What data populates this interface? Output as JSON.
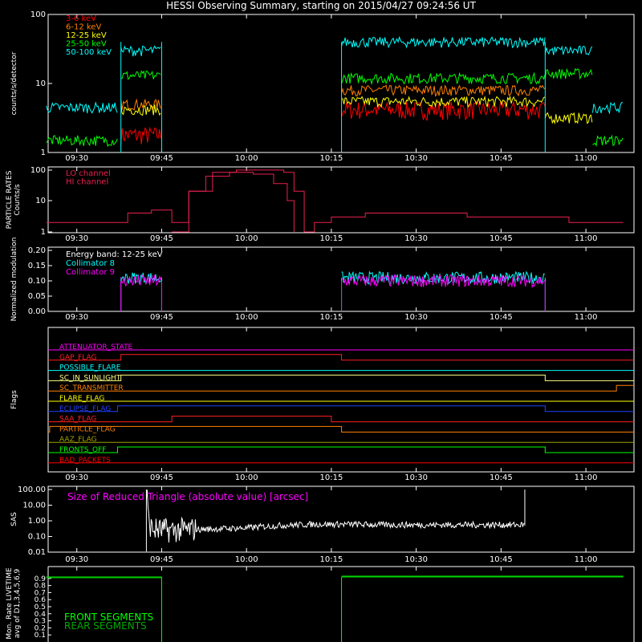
{
  "title": "HESSI Observing Summary, starting on 2015/04/27 09:24:56 UT",
  "time_ticks": [
    "09:30",
    "09:45",
    "10:00",
    "10:15",
    "10:30",
    "10:45",
    "11:00"
  ],
  "colors": {
    "lo": "#ff0000",
    "b612": "#ff8000",
    "b1225": "#ffff00",
    "b2550": "#00ff00",
    "b50100": "#00ffff",
    "particle": "#e8204f",
    "col8": "#00ffff",
    "col9": "#ff00ff",
    "sas_label": "#ff00ff",
    "front": "#00ff00",
    "rear": "#00aa00"
  },
  "chart_data": [
    {
      "type": "line",
      "id": "counts",
      "ylabel": "counts/s/detector",
      "yscale": "log",
      "ylim": [
        1,
        100
      ],
      "yticks": [
        "100",
        "10",
        "1"
      ],
      "legend": [
        "3-6 keV",
        "6-12 keV",
        "12-25 keV",
        "25-50 keV",
        "50-100 keV"
      ],
      "series": [
        {
          "name": "3-6 keV",
          "segments": [
            {
              "x0": 9.63,
              "x1": 9.75,
              "y": 1.8
            },
            {
              "x0": 10.28,
              "x1": 10.88,
              "y": 4.2
            }
          ]
        },
        {
          "name": "6-12 keV",
          "segments": [
            {
              "x0": 9.63,
              "x1": 9.75,
              "y": 5.0
            },
            {
              "x0": 10.28,
              "x1": 10.88,
              "y": 8.0
            }
          ]
        },
        {
          "name": "12-25 keV",
          "segments": [
            {
              "x0": 9.63,
              "x1": 9.75,
              "y": 4.2
            },
            {
              "x0": 10.28,
              "x1": 10.88,
              "y": 5.5
            },
            {
              "x0": 10.88,
              "x1": 11.02,
              "y": 3.2
            }
          ]
        },
        {
          "name": "25-50 keV",
          "segments": [
            {
              "x0": 9.41,
              "x1": 9.62,
              "y": 1.5
            },
            {
              "x0": 9.63,
              "x1": 9.75,
              "y": 13
            },
            {
              "x0": 10.28,
              "x1": 10.88,
              "y": 12
            },
            {
              "x0": 10.88,
              "x1": 11.02,
              "y": 14
            },
            {
              "x0": 11.02,
              "x1": 11.11,
              "y": 1.5
            }
          ]
        },
        {
          "name": "50-100 keV",
          "segments": [
            {
              "x0": 9.41,
              "x1": 9.62,
              "y": 4.5
            },
            {
              "x0": 9.63,
              "x1": 9.75,
              "y": 30
            },
            {
              "x0": 10.28,
              "x1": 10.88,
              "y": 40
            },
            {
              "x0": 10.88,
              "x1": 11.02,
              "y": 30
            },
            {
              "x0": 11.02,
              "x1": 11.11,
              "y": 4.5
            }
          ]
        }
      ]
    },
    {
      "type": "line",
      "id": "particle",
      "ylabel": "PARTICLE RATES Counts/s",
      "ylim": [
        0,
        100
      ],
      "yticks": [
        "100",
        "10",
        "1"
      ],
      "legend": [
        "LO channel",
        "HI channel"
      ],
      "series": [
        {
          "name": "LO channel",
          "x": [
            9.41,
            9.55,
            9.65,
            9.72,
            9.78,
            9.83,
            9.9,
            9.97,
            10.05,
            10.11,
            10.14,
            10.17,
            10.2,
            10.25,
            10.35,
            10.5,
            10.65,
            10.8,
            10.95,
            11.11
          ],
          "y": [
            2,
            2,
            4,
            5,
            2,
            20,
            80,
            95,
            95,
            80,
            20,
            1,
            2,
            3,
            4,
            4,
            3,
            3,
            2,
            2
          ]
        },
        {
          "name": "HI channel",
          "x": [
            9.78,
            9.83,
            9.88,
            9.95,
            10.02,
            10.08,
            10.12,
            10.14
          ],
          "y": [
            1,
            20,
            60,
            80,
            70,
            35,
            10,
            1
          ]
        }
      ]
    },
    {
      "type": "line",
      "id": "modulation",
      "ylabel": "Normalized modulation",
      "ylim": [
        0,
        0.2
      ],
      "yticks": [
        "0.20",
        "0.15",
        "0.10",
        "0.05",
        "0.00"
      ],
      "legend": [
        "Energy band: 12-25 keV",
        "Collimator 8",
        "Collimator 9"
      ],
      "series": [
        {
          "name": "Collimator 8",
          "segments": [
            {
              "x0": 9.63,
              "x1": 9.75,
              "y": 0.11
            },
            {
              "x0": 10.28,
              "x1": 10.88,
              "y": 0.11
            }
          ]
        },
        {
          "name": "Collimator 9",
          "segments": [
            {
              "x0": 9.63,
              "x1": 9.75,
              "y": 0.1
            },
            {
              "x0": 10.28,
              "x1": 10.88,
              "y": 0.1
            }
          ]
        }
      ]
    },
    {
      "type": "line",
      "id": "flags",
      "ylabel": "Flags",
      "legend": [
        "ATTENUATOR_STATE",
        "GAP_FLAG",
        "POSSIBLE_FLARE",
        "SC_IN_SUNLIGHT",
        "SC_TRANSMITTER",
        "FLARE_FLAG",
        "ECLIPSE_FLAG",
        "SAA_FLAG",
        "PARTICLE_FLAG",
        "AAZ_FLAG",
        "FRONTS_OFF",
        "BAD_PACKETS"
      ],
      "series": [
        {
          "name": "ATTENUATOR_STATE",
          "color": "#ff00ff",
          "transitions": []
        },
        {
          "name": "GAP_FLAG",
          "color": "#ff2020",
          "transitions": [
            9.63,
            10.28
          ]
        },
        {
          "name": "POSSIBLE_FLARE",
          "color": "#00ffff",
          "transitions": []
        },
        {
          "name": "SC_IN_SUNLIGHT",
          "color": "#ffff80",
          "transitions": [
            9.63,
            10.88
          ]
        },
        {
          "name": "SC_TRANSMITTER",
          "color": "#ff8000",
          "transitions": [
            11.09
          ]
        },
        {
          "name": "FLARE_FLAG",
          "color": "#ffff00",
          "transitions": []
        },
        {
          "name": "ECLIPSE_FLAG",
          "color": "#2040ff",
          "transitions": [
            9.62,
            10.88
          ]
        },
        {
          "name": "SAA_FLAG",
          "color": "#ff2020",
          "transitions": [
            9.78,
            10.25
          ]
        },
        {
          "name": "PARTICLE_FLAG",
          "color": "#ff8000",
          "transitions": [
            9.42,
            10.28
          ]
        },
        {
          "name": "AAZ_FLAG",
          "color": "#a0a000",
          "transitions": []
        },
        {
          "name": "FRONTS_OFF",
          "color": "#00ff00",
          "transitions": [
            9.62,
            10.88
          ]
        },
        {
          "name": "BAD_PACKETS",
          "color": "#ff0000",
          "transitions": []
        }
      ]
    },
    {
      "type": "line",
      "id": "sas",
      "ylabel": "SAS",
      "yscale": "log",
      "ylim": [
        0.01,
        100
      ],
      "yticks": [
        "100.00",
        "10.00",
        "1.00",
        "0.10",
        "0.01"
      ],
      "legend": [
        "Size of Reduced Triangle (absolute value) [arcsec]"
      ],
      "series": [
        {
          "name": "Size of Reduced Triangle (absolute value) [arcsec]",
          "x": [
            9.7,
            9.71,
            9.72,
            9.75,
            9.8,
            9.9,
            10.0,
            10.1,
            10.2,
            10.3,
            10.4,
            10.5,
            10.6,
            10.7,
            10.8,
            10.82,
            10.83
          ],
          "y": [
            100,
            1,
            0.3,
            0.25,
            0.25,
            0.3,
            0.35,
            0.5,
            0.6,
            0.6,
            0.55,
            0.55,
            0.55,
            0.55,
            0.55,
            0.55,
            100
          ]
        }
      ]
    },
    {
      "type": "line",
      "id": "livetime",
      "ylabel": "Mon. Rate LIVETIME avg of D1,3,4,5,6,9",
      "ylim": [
        0,
        1.0
      ],
      "yticks": [
        "0.9",
        "0.8",
        "0.7",
        "0.6",
        "0.5",
        "0.4",
        "0.3",
        "0.2",
        "0.1"
      ],
      "legend": [
        "FRONT SEGMENTS",
        "REAR SEGMENTS"
      ],
      "series": [
        {
          "name": "FRONT SEGMENTS",
          "segments": [
            {
              "x0": 9.41,
              "x1": 9.75,
              "y": 0.92
            },
            {
              "x0": 10.28,
              "x1": 11.11,
              "y": 0.93
            }
          ]
        },
        {
          "name": "REAR SEGMENTS",
          "segments": [
            {
              "x0": 9.41,
              "x1": 9.75,
              "y": 0.91
            },
            {
              "x0": 10.28,
              "x1": 11.11,
              "y": 0.92
            }
          ]
        }
      ]
    }
  ]
}
